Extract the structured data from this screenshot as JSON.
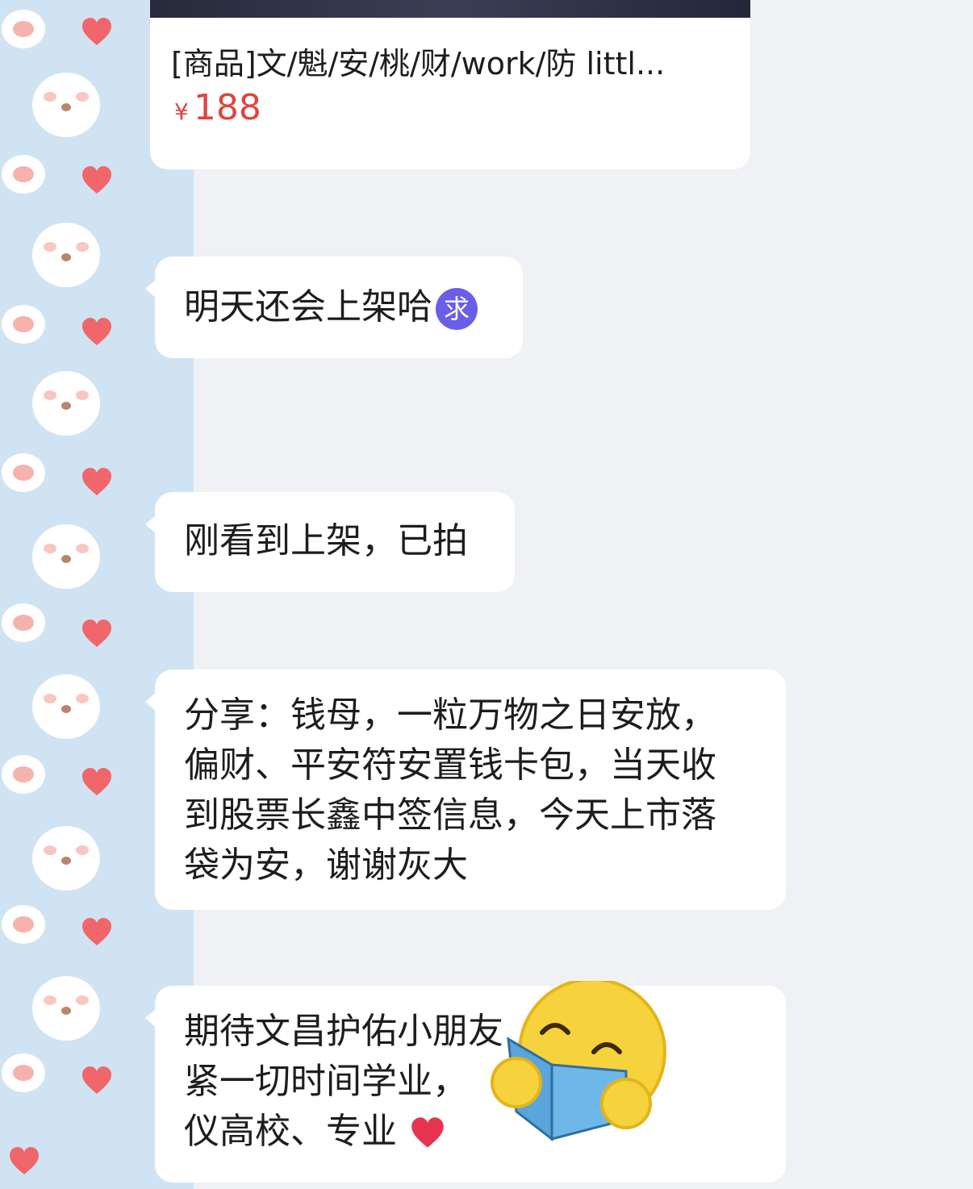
{
  "product": {
    "title": "[商品]文/魁/安/桃/财/work/防 littl...",
    "currency": "¥",
    "price": "188"
  },
  "messages": [
    {
      "text": "明天还会上架哈",
      "emoji": "求",
      "emoji_color": "#6a5ee8"
    },
    {
      "text": "刚看到上架，已拍"
    },
    {
      "lines": [
        "分享：钱母，一粒万物之日安放，",
        "偏财、平安符安置钱卡包，当天收",
        "到股票长鑫中签信息，今天上市落",
        "袋为安，谢谢灰大"
      ]
    },
    {
      "lines": [
        "期待文昌护佑小朋友",
        "紧一切时间学业，",
        "仪高校、专业"
      ],
      "sticker": "reading-face-sticker"
    }
  ],
  "colors": {
    "price": "#e0443e",
    "bubble": "#ffffff",
    "chat_background": "#f0f1f4",
    "wallpaper": "#cfe3f3",
    "heart": "#f0666b"
  },
  "icons": [
    "paw-icon",
    "heart-icon",
    "bear-face-icon",
    "heart-emoji-icon"
  ]
}
